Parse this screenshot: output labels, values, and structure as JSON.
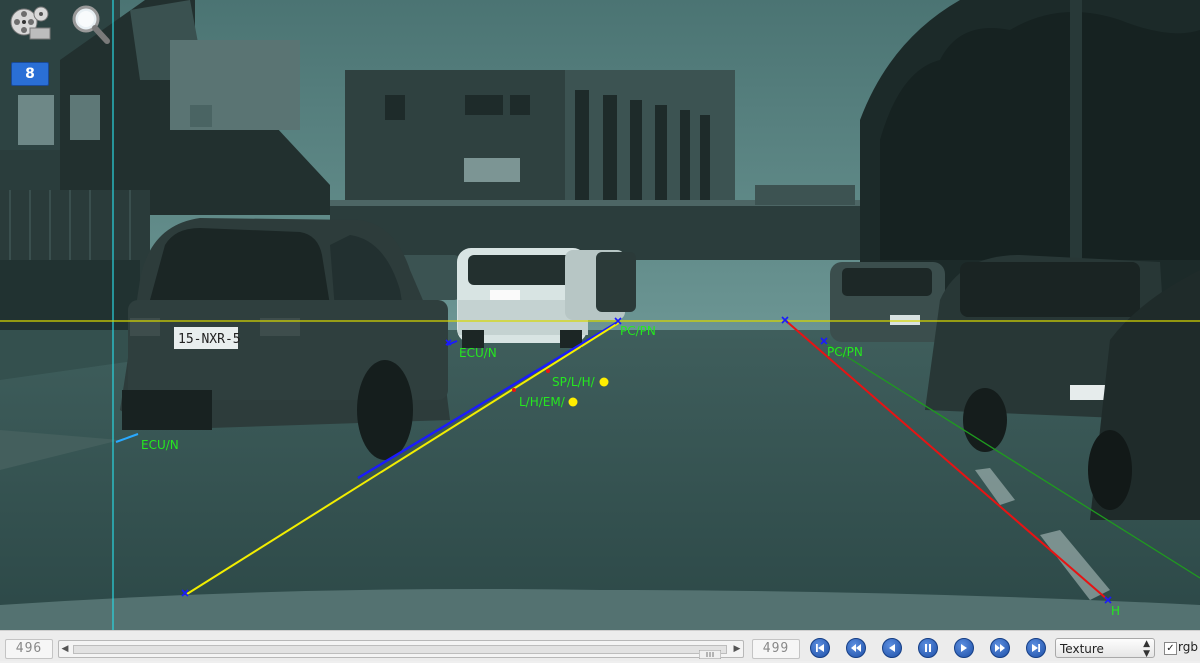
{
  "overlay": {
    "labels": {
      "pc_pn_left": "PC/PN",
      "pc_pn_right": "PC/PN",
      "ecu_n_upper": "ECU/N",
      "ecu_n_lower": "ECU/N",
      "sp_l_h": "SP/L/H/",
      "l_h_em": "L/H/EM/",
      "h": "H"
    },
    "colors": {
      "label_green": "#25e81f",
      "horizon": "#d8d800",
      "vertical_guide": "#29d6e0",
      "left_boundary_yellow": "#f2ee00",
      "left_boundary_blue": "#1a1aff",
      "right_boundary_red": "#e81313",
      "right_boundary_green": "#1f9a1f",
      "marker_dot": "#ffee00"
    },
    "frame_badge": "8",
    "plates": {
      "audi": "15-NXR-5"
    }
  },
  "toolbar_icons": [
    "film-reel-icon",
    "zoom-magnifier-icon"
  ],
  "controls": {
    "current_frame": "496",
    "total_frame": "499",
    "timeline_position": 0.994,
    "mode_select": {
      "value": "Texture"
    },
    "rgb_checkbox": {
      "label": "rgb",
      "checked": true
    },
    "playback_buttons": [
      "first-frame",
      "rewind",
      "step-back",
      "pause",
      "step-forward",
      "fast-forward",
      "last-frame"
    ]
  }
}
